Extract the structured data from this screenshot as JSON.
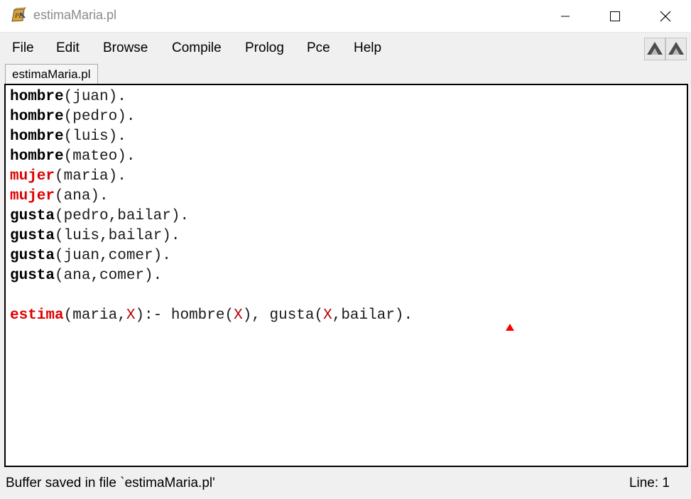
{
  "window": {
    "title": "estimaMaria.pl",
    "app_icon": "swi-prolog-icon",
    "controls": [
      "minimize-icon",
      "maximize-icon",
      "close-icon"
    ]
  },
  "menu": {
    "file": "File",
    "edit": "Edit",
    "browse": "Browse",
    "compile": "Compile",
    "prolog": "Prolog",
    "pce": "Pce",
    "help": "Help"
  },
  "toolbar": {
    "icons": [
      "back-arrow-icon",
      "forward-arrow-icon"
    ]
  },
  "tab": {
    "label": "estimaMaria.pl"
  },
  "editor": {
    "lines": [
      {
        "head": "hombre",
        "rest": "(juan)."
      },
      {
        "head": "hombre",
        "rest": "(pedro)."
      },
      {
        "head": "hombre",
        "rest": "(luis)."
      },
      {
        "head": "hombre",
        "rest": "(mateo)."
      },
      {
        "head": "mujer",
        "rest": "(maria)."
      },
      {
        "head": "mujer",
        "rest": "(ana)."
      },
      {
        "head": "gusta",
        "rest": "(pedro,bailar)."
      },
      {
        "head": "gusta",
        "rest": "(luis,bailar)."
      },
      {
        "head": "gusta",
        "rest": "(juan,comer)."
      },
      {
        "head": "gusta",
        "rest": "(ana,comer)."
      }
    ],
    "rule": {
      "head": "estima",
      "p1": "(maria,",
      "v1": "X",
      "p2": "):- hombre(",
      "v2": "X",
      "p3": "), gusta(",
      "v3": "X",
      "p4": ",bailar)."
    },
    "colors": {
      "keyword": "#000000",
      "keyword_red": "#e00000",
      "variable": "#b40000",
      "caret_marker": "#ff0000"
    }
  },
  "status": {
    "message": "Buffer saved in file `estimaMaria.pl'",
    "line": "Line: 1"
  }
}
